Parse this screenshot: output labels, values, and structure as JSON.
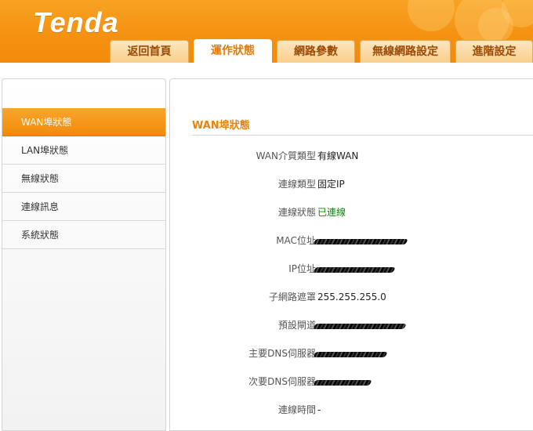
{
  "brand": {
    "logo_text": "Tenda"
  },
  "nav": {
    "tabs": [
      {
        "label": "返回首頁",
        "active": false
      },
      {
        "label": "運作狀態",
        "active": true
      },
      {
        "label": "網路參數",
        "active": false
      },
      {
        "label": "無線網路設定",
        "active": false
      },
      {
        "label": "進階設定",
        "active": false
      }
    ]
  },
  "sidebar": {
    "items": [
      {
        "label": "WAN埠狀態",
        "active": true
      },
      {
        "label": "LAN埠狀態",
        "active": false
      },
      {
        "label": "無線狀態",
        "active": false
      },
      {
        "label": "連線訊息",
        "active": false
      },
      {
        "label": "系統狀態",
        "active": false
      }
    ]
  },
  "main": {
    "title": "WAN埠狀態",
    "rows": [
      {
        "label": "WAN介質類型",
        "value": "有線WAN"
      },
      {
        "label": "連線類型",
        "value": "固定IP"
      },
      {
        "label": "連線狀態",
        "value": "已連線"
      },
      {
        "label": "MAC位址",
        "value": ""
      },
      {
        "label": "IP位址",
        "value": ""
      },
      {
        "label": "子網路遮罩",
        "value": "255.255.255.0"
      },
      {
        "label": "預設閘道",
        "value": ""
      },
      {
        "label": "主要DNS伺服器",
        "value": ""
      },
      {
        "label": "次要DNS伺服器",
        "value": ""
      },
      {
        "label": "連線時間",
        "value": "-"
      }
    ]
  },
  "colors": {
    "accent": "#f28a0a",
    "title": "#e8820a",
    "connected": "#0a8a0a"
  }
}
